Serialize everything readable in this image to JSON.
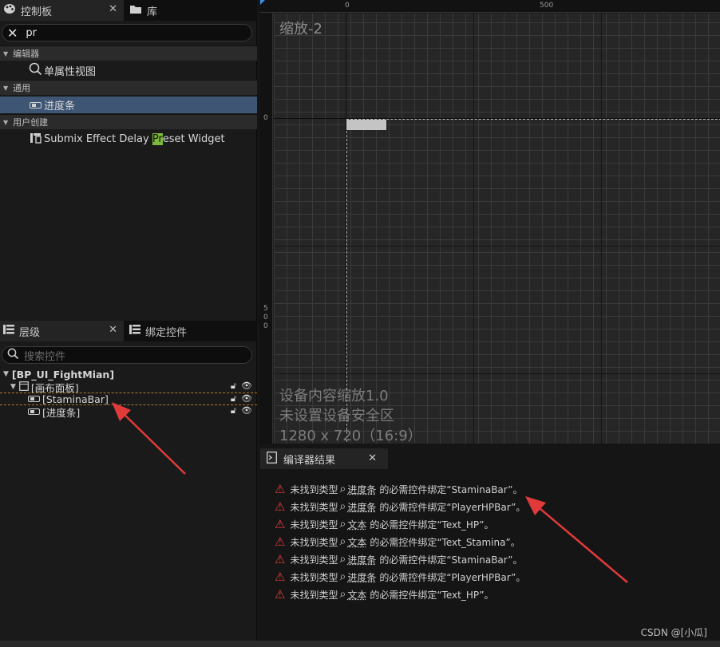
{
  "palette": {
    "tab_bar_bg": "#0f0f0f",
    "selected_row_bg": "#3e5674",
    "search_highlight": "#7eb73b",
    "warning_red": "#e23b3b",
    "arrow_red": "#e03a3a",
    "selection_dash": "#b07a2a"
  },
  "palette_panel": {
    "tab_palette": "控制板",
    "tab_library": "库",
    "search_value": "pr",
    "sections": [
      {
        "label": "编辑器",
        "items": [
          {
            "label": "单属性视图",
            "icon": "magnifier-icon"
          }
        ]
      },
      {
        "label": "通用",
        "items": [
          {
            "label": "进度条",
            "icon": "progress-bar-icon"
          }
        ]
      },
      {
        "label": "用户创建",
        "items": [
          {
            "pre": "Submix Effect Delay ",
            "match": "Pr",
            "post": "eset Widget",
            "icon": "widget-icon"
          }
        ]
      }
    ]
  },
  "hierarchy_panel": {
    "tab_hierarchy": "层级",
    "tab_bind": "绑定控件",
    "search_placeholder": "搜索控件",
    "tree": [
      {
        "label": "[BP_UI_FightMian]"
      },
      {
        "label": "[画布面板]"
      },
      {
        "label": "[StaminaBar]"
      },
      {
        "label": "[进度条]"
      }
    ]
  },
  "designer": {
    "zoom": "缩放-2",
    "ruler_top": [
      "0",
      "500"
    ],
    "ruler_left": [
      "0",
      "5",
      "0",
      "0"
    ],
    "device_info": [
      "设备内容缩放1.0",
      "未设置设备安全区",
      "1280 x 720（16:9）"
    ]
  },
  "compiler": {
    "title": "编译器结果",
    "messages": [
      {
        "pre": "未找到类型",
        "type": "进度条",
        "post": "的必需控件绑定“StaminaBar”。"
      },
      {
        "pre": "未找到类型",
        "type": "进度条",
        "post": "的必需控件绑定“PlayerHPBar”。"
      },
      {
        "pre": "未找到类型",
        "type": "文本",
        "post": "的必需控件绑定“Text_HP”。"
      },
      {
        "pre": "未找到类型",
        "type": "文本",
        "post": "的必需控件绑定“Text_Stamina”。"
      },
      {
        "pre": "未找到类型",
        "type": "进度条",
        "post": "的必需控件绑定“StaminaBar”。"
      },
      {
        "pre": "未找到类型",
        "type": "进度条",
        "post": "的必需控件绑定“PlayerHPBar”。"
      },
      {
        "pre": "未找到类型",
        "type": "文本",
        "post": "的必需控件绑定“Text_HP”。"
      }
    ]
  },
  "watermark": "CSDN @[小瓜]"
}
